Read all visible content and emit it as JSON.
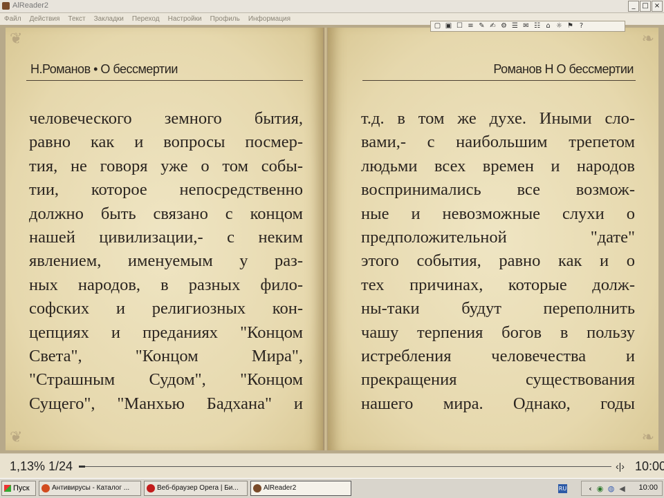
{
  "window": {
    "title": "AlReader2",
    "buttons": [
      "_",
      "□",
      "×"
    ]
  },
  "menu": [
    "Файл",
    "Действия",
    "Текст",
    "Закладки",
    "Переход",
    "Настройки",
    "Профиль",
    "Информация"
  ],
  "toolbar": {
    "icons": [
      "page-icon",
      "select-icon",
      "bookmark-icon",
      "find-icon",
      "pen-icon",
      "tool-icon",
      "pin-icon",
      "toc-icon",
      "note-icon",
      "format-icon",
      "grid-icon",
      "settings-icon",
      "flag-icon",
      "help-icon"
    ],
    "glyphs": [
      "▢",
      "▣",
      "☐",
      "≡",
      "✎",
      "✍",
      "⚙",
      "☰",
      "✉",
      "☷",
      "⌂",
      "☼",
      "⚑",
      "?"
    ]
  },
  "left_page": {
    "header": "Н.Романов • О бессмертии",
    "lines": [
      "человеческого земного бытия,",
      "равно как и вопросы посмер-",
      "тия, не говоря уже о том собы-",
      "тии, которое непосредственно",
      "должно быть связано с концом",
      "нашей цивилизации,- с неким",
      "явлением, именуемым у раз-",
      "ных народов, в разных фило-",
      "софских и религиозных кон-",
      "цепциях и преданиях \"Концом",
      "Света\", \"Концом Мира\",",
      "\"Страшным Судом\", \"Концом",
      "Сущего\", \"Манхью Бадхана\" и"
    ]
  },
  "right_page": {
    "header": "Романов Н О бессмертии",
    "lines": [
      "т.д. в том же духе. Иными сло-",
      "вами,- с наибольшим трепетом",
      "людьми всех времен и народов",
      "воспринимались все возмож-",
      "ные и невозможные слухи о",
      "предположительной \"дате\"",
      "этого события, равно как и о",
      "тех причинах, которые долж-",
      "ны-таки будут переполнить",
      "чашу терпения богов в пользу",
      "истребления человечества и",
      "прекращения существования",
      "нашего мира. Однако, годы"
    ]
  },
  "status": {
    "percent": "1,13%",
    "page": "1/24",
    "progress_fraction": 0.0113,
    "sound_icon": "‹|›",
    "clock": "10:00"
  },
  "taskbar": {
    "start_label": "Пуск",
    "tasks": [
      {
        "label": "Антивирусы - Каталог ...",
        "icon_color": "#d24b1e"
      },
      {
        "label": "Веб-браузер Opera | Би...",
        "icon_color": "#c21b1b"
      },
      {
        "label": "AlReader2",
        "icon_color": "#7a4b2a"
      }
    ],
    "tray_lang": "RU",
    "tray_clock": "10:00"
  }
}
